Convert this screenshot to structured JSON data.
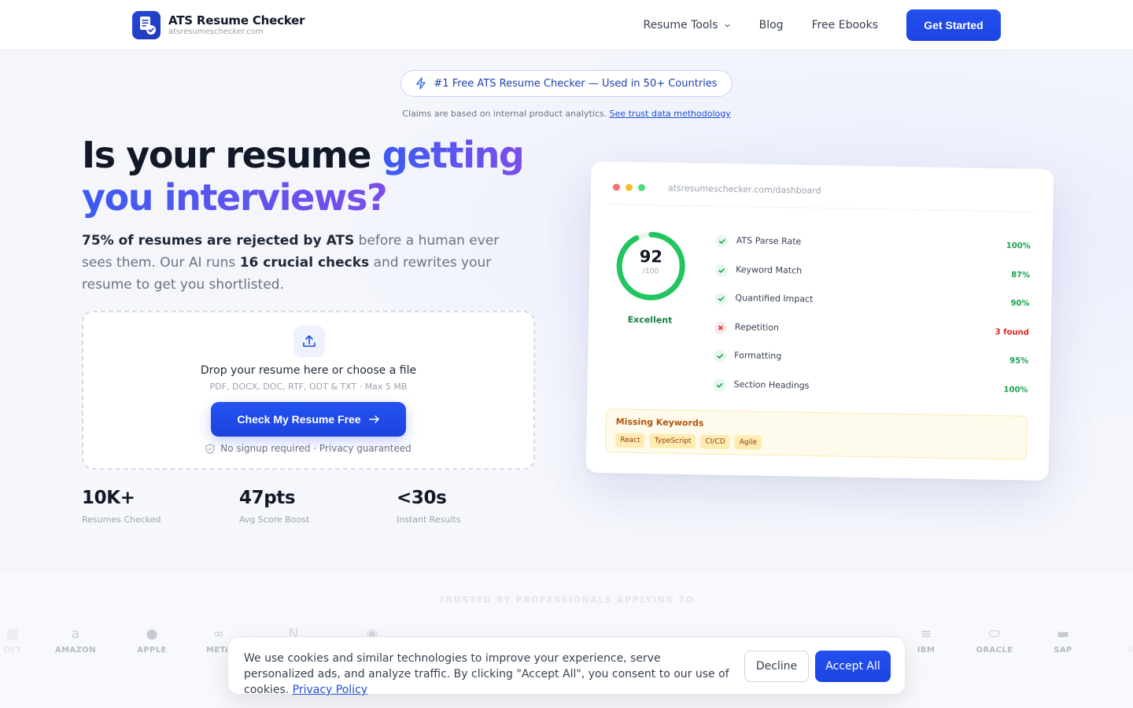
{
  "brand": {
    "name": "ATS Resume Checker",
    "url": "atsresumeschecker.com"
  },
  "nav": {
    "items": [
      "Resume Tools",
      "Blog",
      "Free Ebooks"
    ],
    "cta": "Get Started"
  },
  "badge": "#1 Free ATS Resume Checker — Used in 50+ Countries",
  "claims": {
    "text": "Claims are based on internal product analytics.",
    "link": "See trust data methodology"
  },
  "hero": {
    "headline_plain": "Is your resume ",
    "headline_grad1": "getting",
    "headline_grad2": "you interviews?",
    "sub_b1": "75% of resumes are rejected by ATS",
    "sub_t1": " before a human ever sees them. Our AI runs ",
    "sub_b2": "16 crucial checks",
    "sub_t2": " and rewrites your resume to get you shortlisted."
  },
  "upload": {
    "title": "Drop your resume here or choose a file",
    "formats": "PDF, DOCX, DOC, RTF, ODT & TXT · Max 5 MB",
    "button": "Check My Resume Free",
    "privacy": "No signup required · Privacy guaranteed"
  },
  "stats": [
    {
      "value": "10K+",
      "label": "Resumes Checked"
    },
    {
      "value": "47pts",
      "label": "Avg Score Boost"
    },
    {
      "value": "<30s",
      "label": "Instant Results"
    }
  ],
  "dashboard": {
    "url": "atsresumeschecker.com/dashboard",
    "score": "92",
    "score_den": "/100",
    "score_fraction": 0.92,
    "score_label": "Excellent",
    "checks": [
      {
        "name": "ATS Parse Rate",
        "value": "100%",
        "status": "ok"
      },
      {
        "name": "Keyword Match",
        "value": "87%",
        "status": "ok"
      },
      {
        "name": "Quantified Impact",
        "value": "90%",
        "status": "ok"
      },
      {
        "name": "Repetition",
        "value": "3 found",
        "status": "bad"
      },
      {
        "name": "Formatting",
        "value": "95%",
        "status": "ok"
      },
      {
        "name": "Section Headings",
        "value": "100%",
        "status": "ok"
      }
    ],
    "missing_title": "Missing Keywords",
    "missing_keywords": [
      "React",
      "TypeScript",
      "CI/CD",
      "Agile"
    ]
  },
  "trusted": {
    "title": "TRUSTED BY PROFESSIONALS APPLYING TO",
    "logos": [
      {
        "name": "OFT",
        "icon": "microsoft-icon"
      },
      {
        "name": "AMAZON",
        "icon": "amazon-icon"
      },
      {
        "name": "APPLE",
        "icon": "apple-icon"
      },
      {
        "name": "META",
        "icon": "meta-icon"
      },
      {
        "name": "NETFLIX",
        "icon": "netflix-icon"
      },
      {
        "name": "SPOTIFY",
        "icon": "spotify-icon"
      },
      {
        "name": "IBM",
        "icon": "ibm-icon"
      },
      {
        "name": "ORACLE",
        "icon": "oracle-icon"
      },
      {
        "name": "SAP",
        "icon": "sap-icon"
      },
      {
        "name": "INTE",
        "icon": "intel-icon"
      }
    ]
  },
  "cookie": {
    "text": "We use cookies and similar technologies to improve your experience, serve personalized ads, and analyze traffic. By clicking \"Accept All\", you consent to our use of cookies.",
    "link": "Privacy Policy",
    "decline": "Decline",
    "accept": "Accept All"
  },
  "colors": {
    "primary": "#1d4ed8",
    "success": "#16a34a",
    "danger": "#dc2626",
    "warning": "#b45309"
  }
}
